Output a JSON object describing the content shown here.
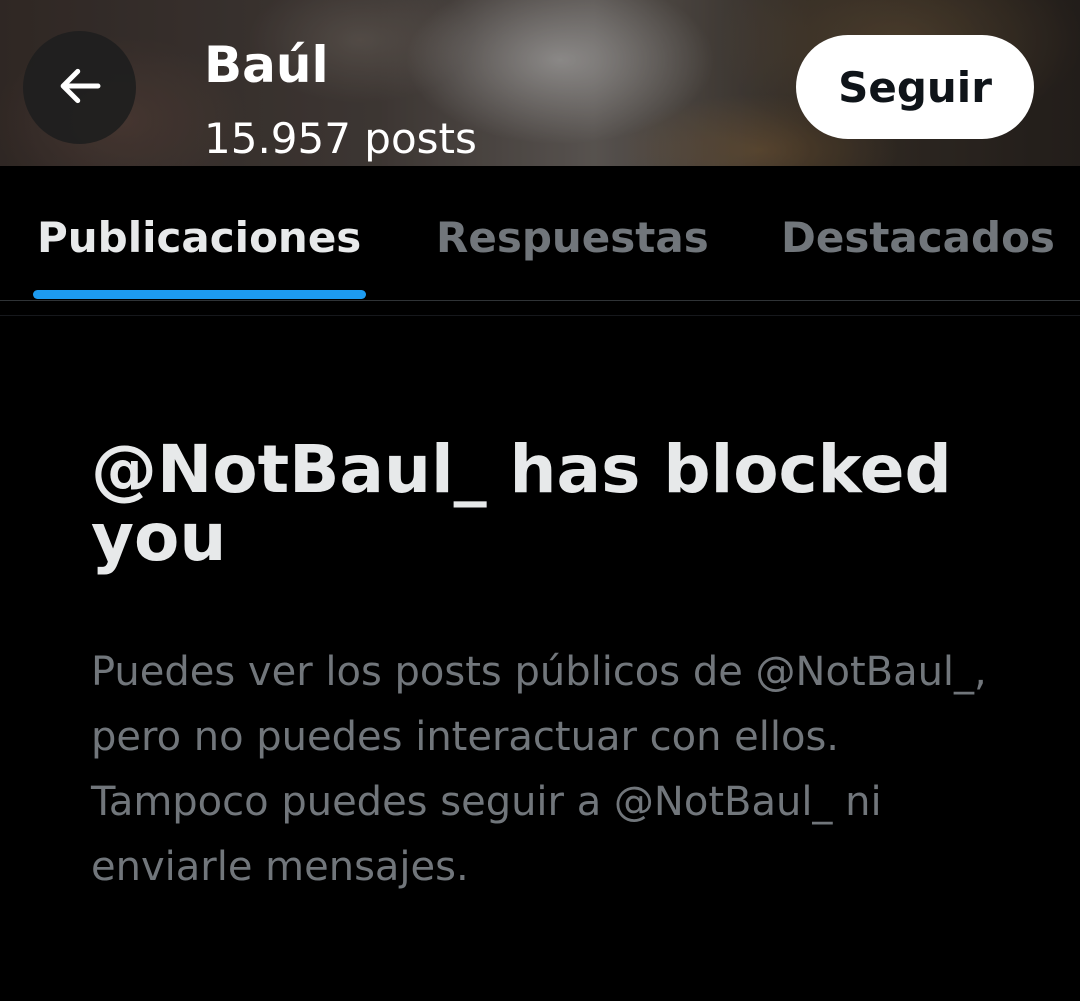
{
  "header": {
    "title": "Baúl",
    "posts_count": "15.957 posts",
    "follow_label": "Seguir",
    "back_icon": "arrow-left-icon"
  },
  "tabs": [
    {
      "label": "Publicaciones",
      "active": true
    },
    {
      "label": "Respuestas",
      "active": false
    },
    {
      "label": "Destacados",
      "active": false
    }
  ],
  "blocked": {
    "title": "@NotBaul_ has blocked you",
    "description": "Puedes ver los posts públicos de @NotBaul_, pero no puedes interactuar con ellos. Tampoco puedes seguir a @NotBaul_ ni enviarle mensajes."
  },
  "colors": {
    "background": "#000000",
    "accent": "#1d9bf0",
    "primary_text": "#e7e9ea",
    "secondary_text": "#71767b",
    "button_bg": "#ffffff"
  }
}
